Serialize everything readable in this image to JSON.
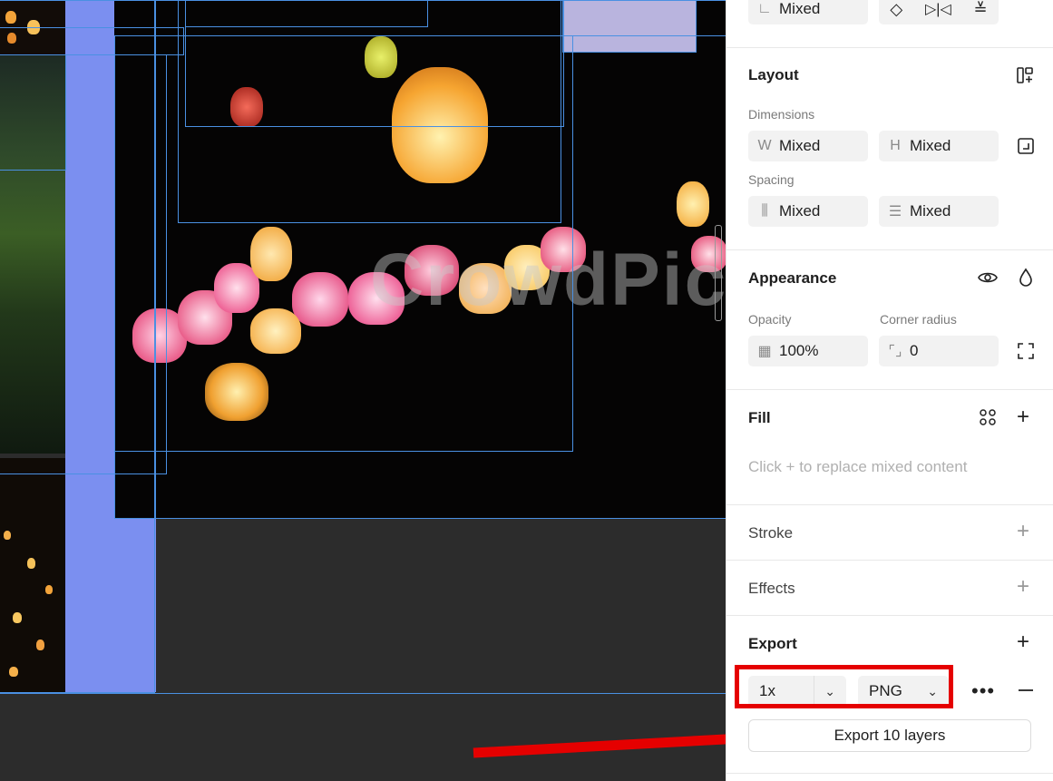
{
  "top": {
    "constraint_value": "Mixed"
  },
  "layout": {
    "title": "Layout",
    "dimensions_label": "Dimensions",
    "w_prefix": "W",
    "w_value": "Mixed",
    "h_prefix": "H",
    "h_value": "Mixed",
    "spacing_label": "Spacing",
    "spacing_h_value": "Mixed",
    "spacing_v_value": "Mixed"
  },
  "appearance": {
    "title": "Appearance",
    "opacity_label": "Opacity",
    "opacity_value": "100%",
    "corner_label": "Corner radius",
    "corner_value": "0"
  },
  "fill": {
    "title": "Fill",
    "hint": "Click + to replace mixed content"
  },
  "stroke": {
    "title": "Stroke"
  },
  "effects": {
    "title": "Effects"
  },
  "export": {
    "title": "Export",
    "scale": "1x",
    "format": "PNG",
    "button": "Export 10 layers"
  },
  "canvas": {
    "watermark": "CrowdPic"
  },
  "colors": {
    "accent": "#4a90e2",
    "highlight": "#e50000",
    "selection_fill": "#7b8ff0"
  },
  "icons": [
    "constraint-icon",
    "align-icon",
    "flip-horizontal-icon",
    "distribute-icon",
    "layout-grid-icon",
    "resize-icon",
    "spacing-horizontal-icon",
    "spacing-vertical-icon",
    "eye-icon",
    "drop-icon",
    "opacity-icon",
    "corner-radius-icon",
    "independent-corners-icon",
    "style-grid-icon",
    "plus-icon",
    "more-icon",
    "minus-icon",
    "chevron-down-icon"
  ]
}
